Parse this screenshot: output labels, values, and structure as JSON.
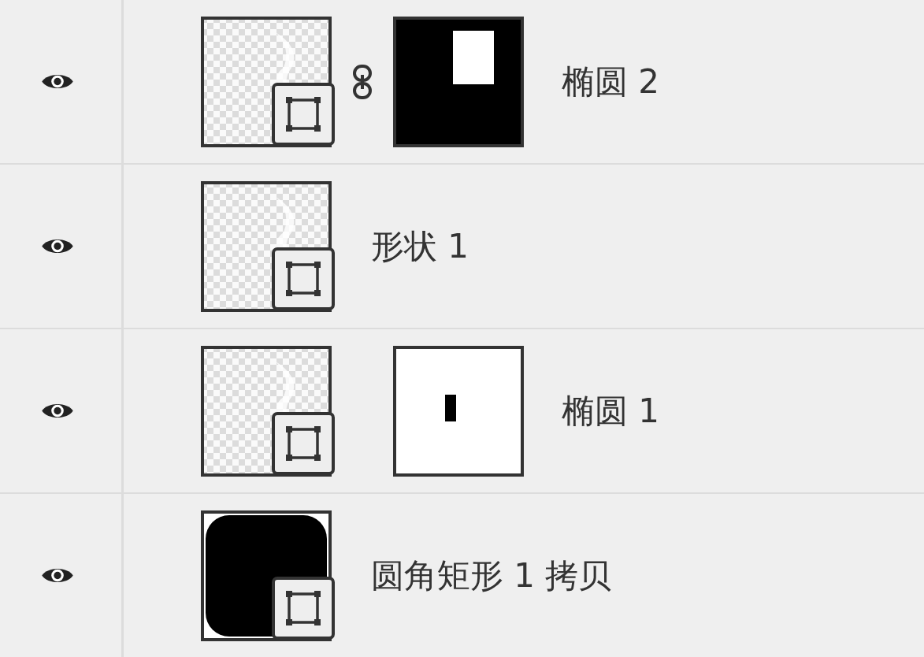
{
  "layers": [
    {
      "name": "椭圆 2",
      "visible": true,
      "thumbnail": {
        "kind": "transparent"
      },
      "linked": true,
      "mask": {
        "kind": "dark"
      }
    },
    {
      "name": "形状 1",
      "visible": true,
      "thumbnail": {
        "kind": "transparent"
      }
    },
    {
      "name": "椭圆 1",
      "visible": true,
      "thumbnail": {
        "kind": "transparent"
      },
      "linked": false,
      "mask": {
        "kind": "light"
      }
    },
    {
      "name": "圆角矩形 1 拷贝",
      "visible": true,
      "thumbnail": {
        "kind": "filled"
      }
    }
  ]
}
